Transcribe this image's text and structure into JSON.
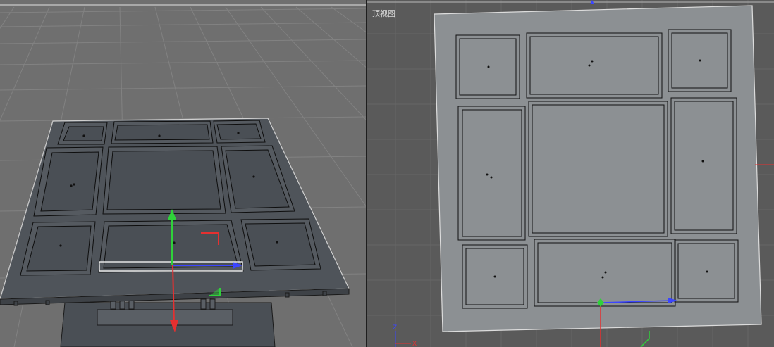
{
  "viewports": {
    "perspective": {
      "label": ""
    },
    "top": {
      "label": "顶视图"
    }
  },
  "colors": {
    "background_persp": "#6f6f6f",
    "background_top": "#5a5a5a",
    "grid": "#7e7e7e",
    "model_face": "#4f545a",
    "model_face_top": "#8c9093",
    "edge": "#111111",
    "axis_x": "#e53030",
    "axis_y": "#2fd23a",
    "axis_z": "#3b45ff"
  },
  "icons": [
    "axis-gizmo-icon",
    "move-manipulator-icon"
  ]
}
